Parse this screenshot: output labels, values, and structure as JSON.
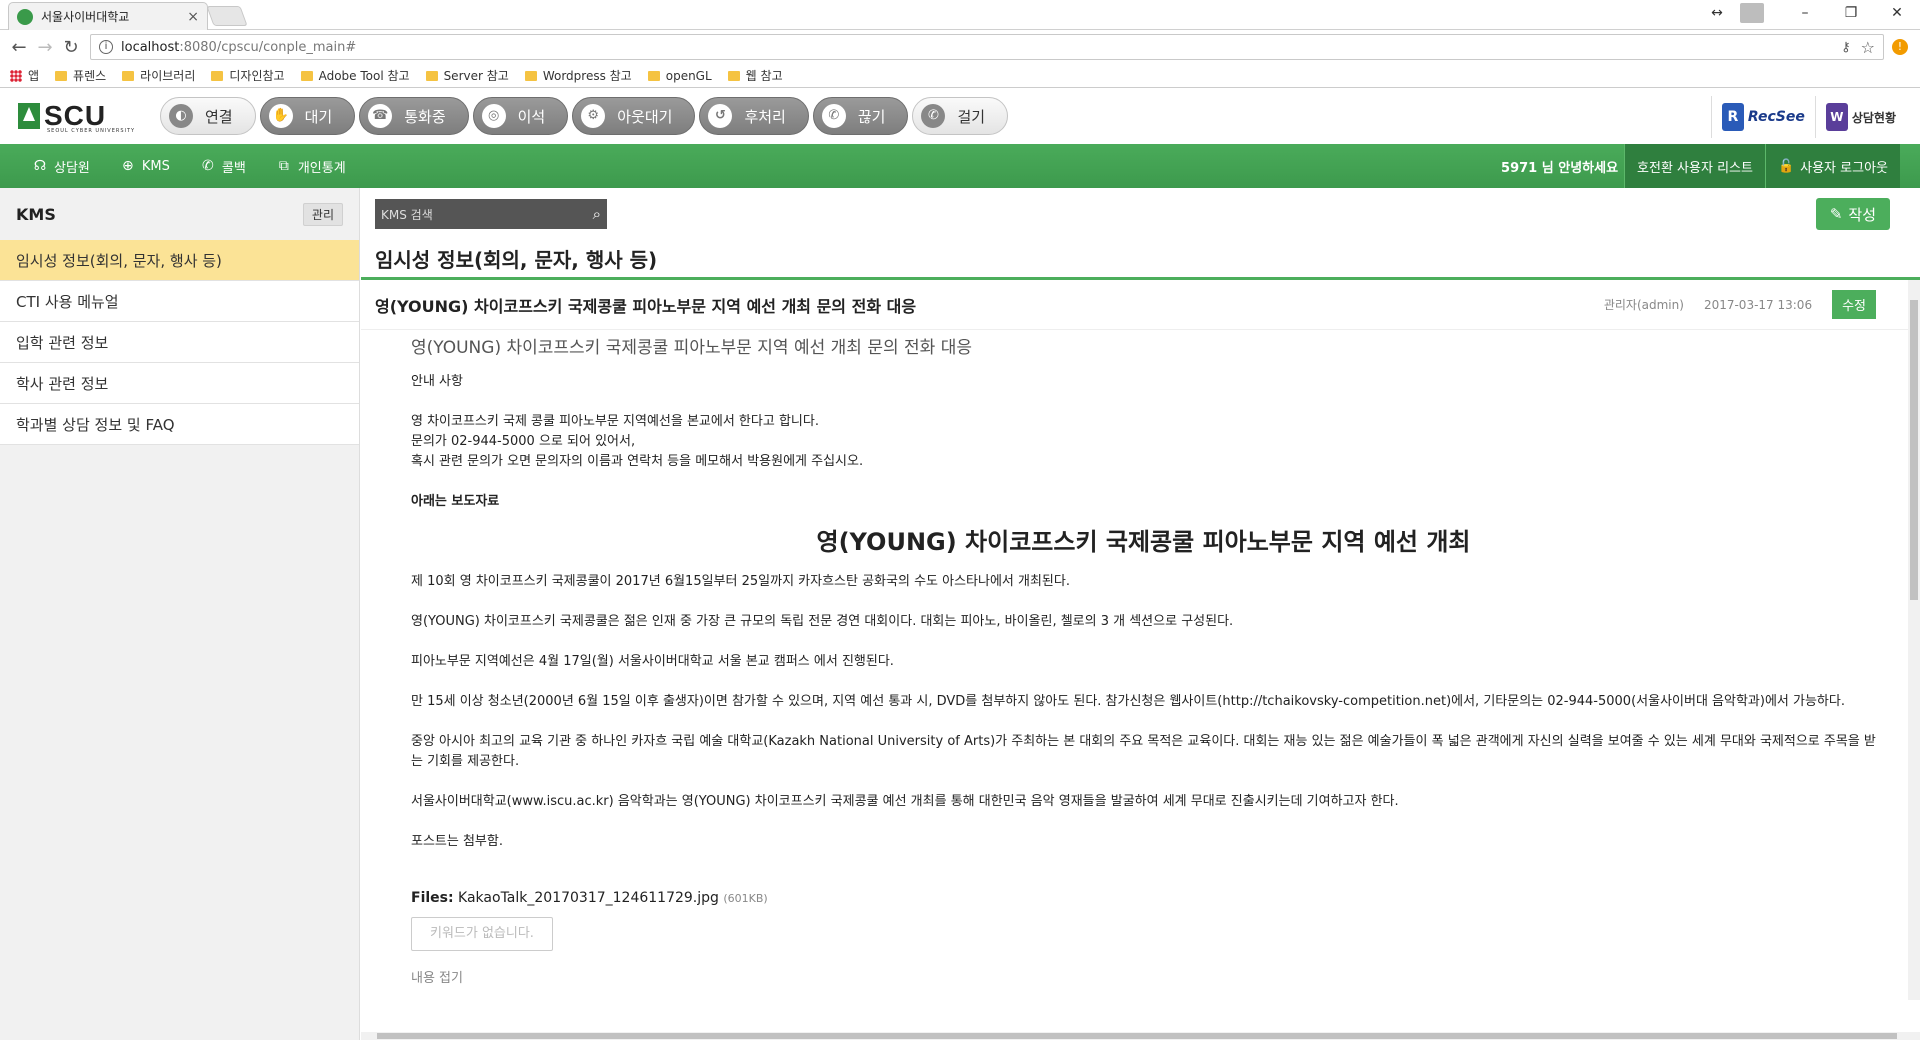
{
  "browser": {
    "tab_title": "서울사이버대학교",
    "tab_close": "×",
    "url_host": "localhost",
    "url_rest": ":8080/cpscu/conple_main#",
    "bookmarks": [
      "앱",
      "퓨렌스",
      "라이브러리",
      "디자인참고",
      "Adobe Tool 참고",
      "Server 참고",
      "Wordpress 참고",
      "openGL",
      "웹 참고"
    ],
    "window_controls": [
      "↔",
      "–",
      "❐",
      "✕"
    ]
  },
  "header": {
    "logo_text": "SCU",
    "logo_sub": "SEOUL CYBER UNIVERSITY",
    "cti_buttons": [
      {
        "label": "연결",
        "icon": "connect-icon"
      },
      {
        "label": "대기",
        "icon": "wait-icon"
      },
      {
        "label": "통화중",
        "icon": "oncall-icon"
      },
      {
        "label": "이석",
        "icon": "away-icon"
      },
      {
        "label": "아웃대기",
        "icon": "outwait-icon"
      },
      {
        "label": "후처리",
        "icon": "postprocess-icon"
      },
      {
        "label": "끊기",
        "icon": "hangup-icon"
      },
      {
        "label": "걸기",
        "icon": "dial-icon"
      }
    ],
    "right_logos": [
      "RecSee",
      "상담현황"
    ]
  },
  "nav": {
    "items": [
      {
        "label": "상담원",
        "icon": "headset-icon"
      },
      {
        "label": "KMS",
        "icon": "globe-icon"
      },
      {
        "label": "콜백",
        "icon": "callback-icon"
      },
      {
        "label": "개인통계",
        "icon": "chart-icon"
      }
    ],
    "greeting": "5971 님 안녕하세요",
    "user_list": "호전환 사용자 리스트",
    "logout": "사용자 로그아웃"
  },
  "sidebar": {
    "title": "KMS",
    "manage": "관리",
    "items": [
      "임시성 정보(회의, 문자, 행사 등)",
      "CTI 사용 메뉴얼",
      "입학 관련 정보",
      "학사 관련 정보",
      "학과별 상담 정보 및 FAQ"
    ],
    "active_index": 0
  },
  "main": {
    "search_placeholder": "KMS 검색",
    "write_label": "작성",
    "category_title": "임시성 정보(회의, 문자, 행사 등)",
    "article": {
      "title": "영(YOUNG) 차이코프스키 국제콩쿨 피아노부문 지역 예선 개최 문의 전화 대응",
      "author": "관리자(admin)",
      "date": "2017-03-17 13:06",
      "edit_label": "수정",
      "subtitle": "영(YOUNG) 차이코프스키 국제콩쿨 피아노부문 지역 예선 개최 문의 전화 대응",
      "notice_heading": "안내 사항",
      "notice_lines": [
        "영 차이코프스키 국제 콩쿨 피아노부문 지역예선을 본교에서 한다고 합니다.",
        "문의가 02-944-5000 으로 되어 있어서,",
        "혹시 관련 문의가 오면 문의자의 이름과 연락처 등을 메모해서 박용원에게 주십시오."
      ],
      "press_heading": "아래는 보도자료",
      "press_title": "영(YOUNG) 차이코프스키 국제콩쿨 피아노부문 지역 예선 개최",
      "paragraphs": [
        "제 10회 영 차이코프스키 국제콩쿨이 2017년 6월15일부터 25일까지 카자흐스탄 공화국의 수도 아스타나에서 개최된다.",
        "영(YOUNG) 차이코프스키 국제콩쿨은 젊은 인재 중 가장 큰 규모의 독립 전문 경연 대회이다. 대회는 피아노, 바이올린, 첼로의 3 개 섹션으로 구성된다.",
        "피아노부문 지역예선은 4월 17일(월) 서울사이버대학교 서울 본교 캠퍼스 에서 진행된다.",
        "만 15세 이상 청소년(2000년 6월 15일 이후 출생자)이면 참가할 수 있으며, 지역 예선 통과 시, DVD를 첨부하지 않아도 된다. 참가신청은 웹사이트(http://tchaikovsky-competition.net)에서, 기타문의는 02-944-5000(서울사이버대 음악학과)에서 가능하다.",
        "중앙 아시아 최고의 교육 기관 중 하나인 카자흐 국립 예술 대학교(Kazakh National University of Arts)가 주최하는 본 대회의 주요 목적은 교육이다. 대회는 재능 있는 젊은 예술가들이 폭 넓은 관객에게 자신의 실력을 보여줄 수 있는 세계 무대와 국제적으로 주목을 받는 기회를 제공한다.",
        "서울사이버대학교(www.iscu.ac.kr) 음악학과는 영(YOUNG) 차이코프스키 국제콩쿨 예선 개최를 통해 대한민국 음악 영재들을 발굴하여 세계 무대로 진출시키는데 기여하고자 한다.",
        "포스트는 첨부함."
      ],
      "files_label": "Files:",
      "file_name": "KakaoTalk_20170317_124611729.jpg",
      "file_size": "(601KB)",
      "keyword_button": "키워드가 없습니다.",
      "fold_label": "내용 접기"
    }
  }
}
